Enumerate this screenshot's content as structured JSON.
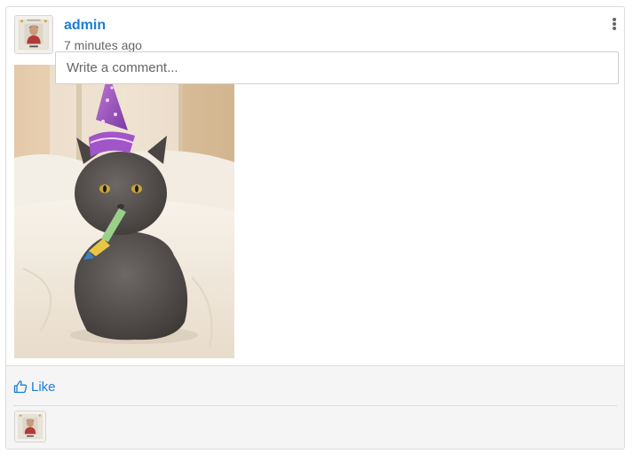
{
  "post": {
    "author": "admin",
    "timestamp": "7 minutes ago",
    "image_alt": "cat-party-hat-photo"
  },
  "actions": {
    "like_label": "Like"
  },
  "comment": {
    "placeholder": "Write a comment..."
  },
  "icons": {
    "menu": "vertical-ellipsis-icon",
    "like": "thumbs-up-icon"
  },
  "colors": {
    "link": "#1c7ed6",
    "footer_bg": "#f5f5f5",
    "border": "#dcdcdc"
  }
}
